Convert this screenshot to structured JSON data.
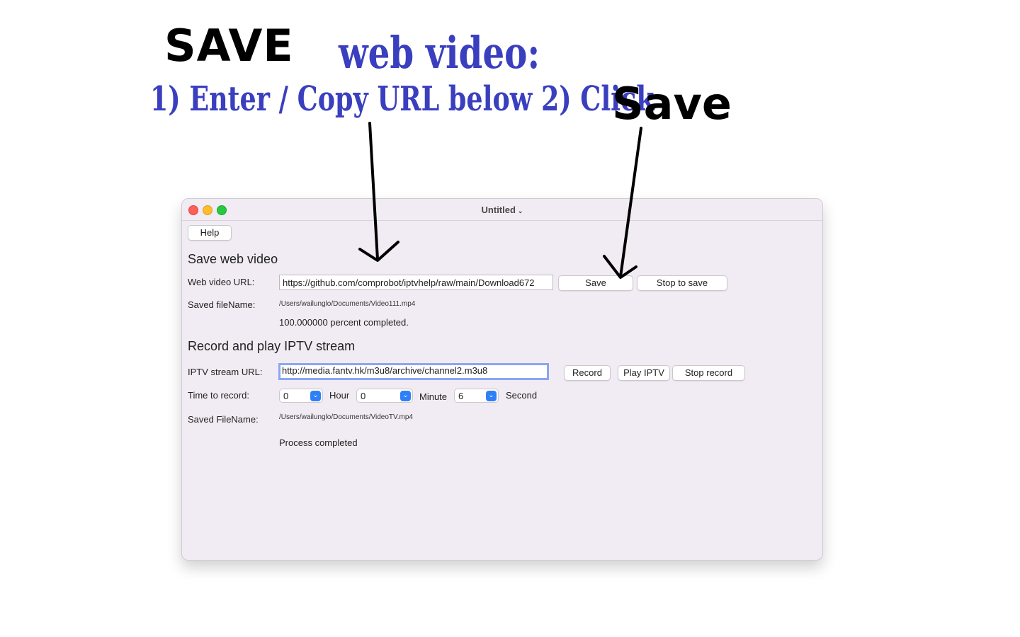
{
  "annotation": {
    "heading_save": "SAVE",
    "heading_web_video": "web video:",
    "steps": "1)  Enter / Copy URL below 2) Click ",
    "save_word": "Save"
  },
  "window": {
    "title": "Untitled",
    "help_label": "Help"
  },
  "web_section": {
    "title": "Save  web video",
    "url_label": "Web video URL:",
    "url_value": "https://github.com/comprobot/iptvhelp/raw/main/Download672",
    "save_button": "Save",
    "stop_button": "Stop to save",
    "filename_label": "Saved fileName:",
    "filename_value": "/Users/wailunglo/Documents/Video111.mp4",
    "progress_text": "100.000000  percent completed."
  },
  "iptv_section": {
    "title": "Record  and play IPTV stream",
    "url_label": "IPTV stream URL:",
    "url_value": "http://media.fantv.hk/m3u8/archive/channel2.m3u8",
    "record_button": "Record",
    "play_button": "Play IPTV",
    "stop_button": "Stop record",
    "time_label": "Time to record:",
    "hour_value": "0",
    "hour_label": "Hour",
    "minute_value": "0",
    "minute_label": "Minute",
    "second_value": "6",
    "second_label": "Second",
    "filename_label": "Saved FileName:",
    "filename_value": "/Users/wailunglo/Documents/VideoTV.mp4",
    "status_text": "Process completed"
  },
  "colors": {
    "annotation_blue": "#3a3fbf",
    "focus_ring": "#8aa6f3",
    "select_accent": "#2f7ff7"
  }
}
